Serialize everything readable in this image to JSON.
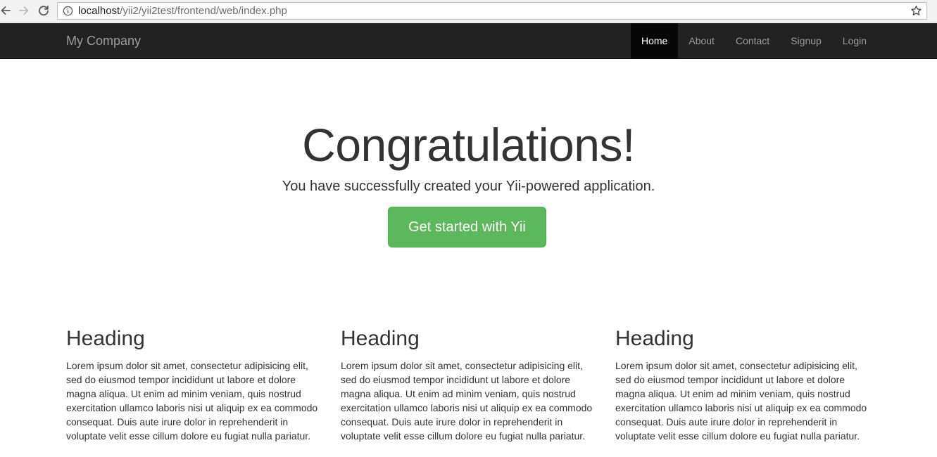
{
  "browser": {
    "url_host": "localhost",
    "url_path": "/yii2/yii2test/frontend/web/index.php",
    "icons": {
      "back": "arrow-left-icon",
      "forward": "arrow-right-icon",
      "reload": "reload-icon",
      "info": "info-icon",
      "bookmark": "star-icon"
    }
  },
  "navbar": {
    "brand": "My Company",
    "items": [
      {
        "label": "Home",
        "active": true
      },
      {
        "label": "About",
        "active": false
      },
      {
        "label": "Contact",
        "active": false
      },
      {
        "label": "Signup",
        "active": false
      },
      {
        "label": "Login",
        "active": false
      }
    ],
    "colors": {
      "background": "#222222",
      "active_background": "#080808",
      "link": "#9d9d9d",
      "active_link": "#ffffff"
    }
  },
  "jumbotron": {
    "title": "Congratulations!",
    "lead": "You have successfully created your Yii-powered application.",
    "button_label": "Get started with Yii",
    "button_color": "#5cb85c"
  },
  "columns": [
    {
      "heading": "Heading",
      "body": "Lorem ipsum dolor sit amet, consectetur adipisicing elit, sed do eiusmod tempor incididunt ut labore et dolore magna aliqua. Ut enim ad minim veniam, quis nostrud exercitation ullamco laboris nisi ut aliquip ex ea commodo consequat. Duis aute irure dolor in reprehenderit in voluptate velit esse cillum dolore eu fugiat nulla pariatur."
    },
    {
      "heading": "Heading",
      "body": "Lorem ipsum dolor sit amet, consectetur adipisicing elit, sed do eiusmod tempor incididunt ut labore et dolore magna aliqua. Ut enim ad minim veniam, quis nostrud exercitation ullamco laboris nisi ut aliquip ex ea commodo consequat. Duis aute irure dolor in reprehenderit in voluptate velit esse cillum dolore eu fugiat nulla pariatur."
    },
    {
      "heading": "Heading",
      "body": "Lorem ipsum dolor sit amet, consectetur adipisicing elit, sed do eiusmod tempor incididunt ut labore et dolore magna aliqua. Ut enim ad minim veniam, quis nostrud exercitation ullamco laboris nisi ut aliquip ex ea commodo consequat. Duis aute irure dolor in reprehenderit in voluptate velit esse cillum dolore eu fugiat nulla pariatur."
    }
  ]
}
